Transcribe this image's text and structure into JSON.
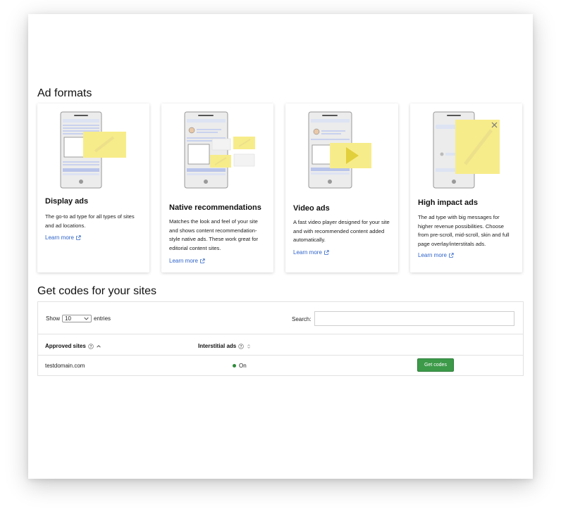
{
  "section_ad_formats": "Ad formats",
  "section_codes": "Get codes for your sites",
  "cards": [
    {
      "title": "Display ads",
      "desc": "The go-to ad type for all types of sites and ad locations.",
      "link": "Learn more"
    },
    {
      "title": "Native recommendations",
      "desc": "Matches the look and feel of your site and shows content recommendation-style native ads. These work great for editorial content sites.",
      "link": "Learn more"
    },
    {
      "title": "Video ads",
      "desc": "A fast video player designed for your site and with recommended content added automatically.",
      "link": "Learn more"
    },
    {
      "title": "High impact ads",
      "desc": "The ad type with big messages for higher revenue possibilities. Choose from pre-scroll, mid-scroll, skin and full page overlay/interstitals ads.",
      "link": "Learn more"
    }
  ],
  "table": {
    "show_label": "Show",
    "entries_value": "10",
    "entries_label": "entries",
    "search_label": "Search:",
    "search_value": "",
    "columns": [
      "Approved sites",
      "Interstitial ads"
    ],
    "rows": [
      {
        "site": "testdomain.com",
        "interstitial": "On",
        "action": "Get codes"
      }
    ]
  },
  "colors": {
    "accent_yellow": "#f7ec8a",
    "link_blue": "#2f63c8",
    "button_green": "#3c9a49",
    "status_green": "#2e8a3b"
  },
  "icons": {
    "external_link": "external-link-icon",
    "help": "help-circle-icon",
    "sort_asc": "sort-asc-icon",
    "sort_both": "sort-both-icon",
    "close": "close-icon",
    "play": "play-icon"
  }
}
